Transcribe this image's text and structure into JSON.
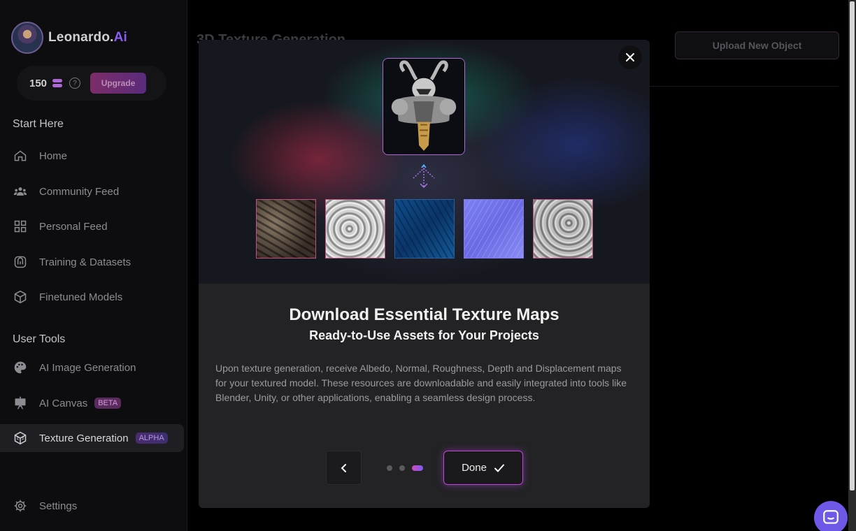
{
  "brand": {
    "name_main": "Leonardo.",
    "name_accent": "Ai"
  },
  "credits": {
    "count": "150",
    "upgrade_label": "Upgrade",
    "help_glyph": "?"
  },
  "sidebar": {
    "start_title": "Start Here",
    "start_items": [
      {
        "label": "Home",
        "icon": "home-icon"
      },
      {
        "label": "Community Feed",
        "icon": "community-icon"
      },
      {
        "label": "Personal Feed",
        "icon": "grid-icon"
      },
      {
        "label": "Training & Datasets",
        "icon": "training-icon"
      },
      {
        "label": "Finetuned Models",
        "icon": "cube-icon"
      }
    ],
    "tools_title": "User Tools",
    "tool_items": [
      {
        "label": "AI Image Generation",
        "icon": "palette-icon"
      },
      {
        "label": "AI Canvas",
        "icon": "easel-icon",
        "badge": "BETA"
      },
      {
        "label": "Texture Generation",
        "icon": "texture-cube-icon",
        "badge": "ALPHA",
        "active": true
      }
    ],
    "settings_label": "Settings"
  },
  "main": {
    "title": "3D Texture Generation",
    "upload_label": "Upload New Object"
  },
  "modal": {
    "title": "Download Essential Texture Maps",
    "subtitle": "Ready-to-Use Assets for Your Projects",
    "description": "Upon texture generation, receive Albedo, Normal, Roughness, Depth and Displacement maps for your textured model. These resources are downloadable and easily integrated into tools like Blender, Unity, or other applications, enabling a seamless design process.",
    "done_label": "Done",
    "pagination": {
      "total": 3,
      "current": 3
    }
  },
  "colors": {
    "accent": "#c246d9",
    "brand_purple": "#8a5cf0",
    "chat": "#6e58e8"
  }
}
